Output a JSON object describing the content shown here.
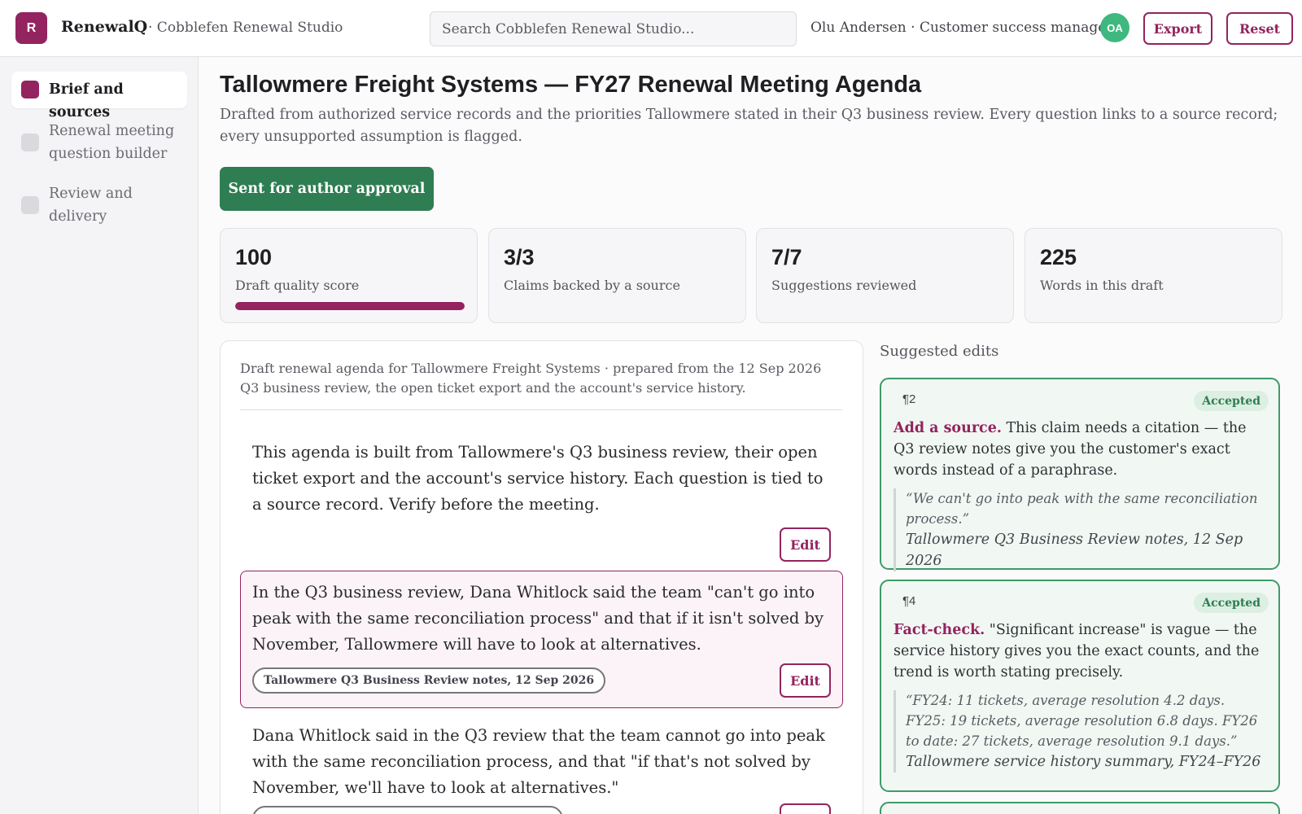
{
  "app": {
    "logo_letter": "R",
    "brand": "RenewalQ",
    "workspace": "· Cobblefen Renewal Studio",
    "search_placeholder": "Search Cobblefen Renewal Studio...",
    "user": "Olu Andersen · Customer success manager",
    "avatar_initials": "OA",
    "export_label": "Export",
    "reset_label": "Reset",
    "accent_color": "#93245f",
    "success_color": "#2f7d52"
  },
  "sidebar": {
    "items": [
      {
        "label": "Brief and sources",
        "active": true
      },
      {
        "label": "Renewal meeting question builder",
        "active": false
      },
      {
        "label": "Review and delivery",
        "active": false
      }
    ]
  },
  "main": {
    "title": "Tallowmere Freight Systems — FY27 Renewal Meeting Agenda",
    "subtitle": "Drafted from authorized service records and the priorities Tallowmere stated in their Q3 business review. Every question links to a source record; every unsupported assumption is flagged.",
    "status_button": "Sent for author approval",
    "stats": [
      {
        "value": "100",
        "label": "Draft quality score",
        "progress": 1.0
      },
      {
        "value": "3/3",
        "label": "Claims backed by a source"
      },
      {
        "value": "7/7",
        "label": "Suggestions reviewed"
      },
      {
        "value": "225",
        "label": "Words in this draft"
      }
    ]
  },
  "draft": {
    "header": "Draft renewal agenda for Tallowmere Freight Systems · prepared from the 12 Sep 2026 Q3 business review, the open ticket export and the account's service history.",
    "edit_label": "Edit",
    "paragraphs": [
      {
        "text": "This agenda is built from Tallowmere's Q3 business review, their open ticket export and the account's service history. Each question is tied to a source record. Verify before the meeting.",
        "source": ""
      },
      {
        "text": "In the Q3 business review, Dana Whitlock said the team \"can't go into peak with the same reconciliation process\" and that if it isn't solved by November, Tallowmere will have to look at alternatives.",
        "source": "Tallowmere Q3 Business Review notes, 12 Sep 2026"
      },
      {
        "text": "Dana Whitlock said in the Q3 review that the team cannot go into peak with the same reconciliation process, and that \"if that's not solved by November, we'll have to look at alternatives.\"",
        "source": ""
      }
    ]
  },
  "suggestions": {
    "heading": "Suggested edits",
    "items": [
      {
        "para": "¶2",
        "status": "Accepted",
        "kind": "Add a source.",
        "body": " This claim needs a citation — the Q3 review notes give you the customer's exact words instead of a paraphrase.",
        "quote": "“We can't go into peak with the same reconciliation process.”",
        "source": "Tallowmere Q3 Business Review notes, 12 Sep 2026"
      },
      {
        "para": "¶4",
        "status": "Accepted",
        "kind": "Fact-check.",
        "body": " \"Significant increase\" is vague — the service history gives you the exact counts, and the trend is worth stating precisely.",
        "quote": "“FY24: 11 tickets, average resolution 4.2 days. FY25: 19 tickets, average resolution 6.8 days. FY26 to date: 27 tickets, average resolution 9.1 days.”",
        "source": "Tallowmere service history summary, FY24–FY26"
      }
    ]
  }
}
